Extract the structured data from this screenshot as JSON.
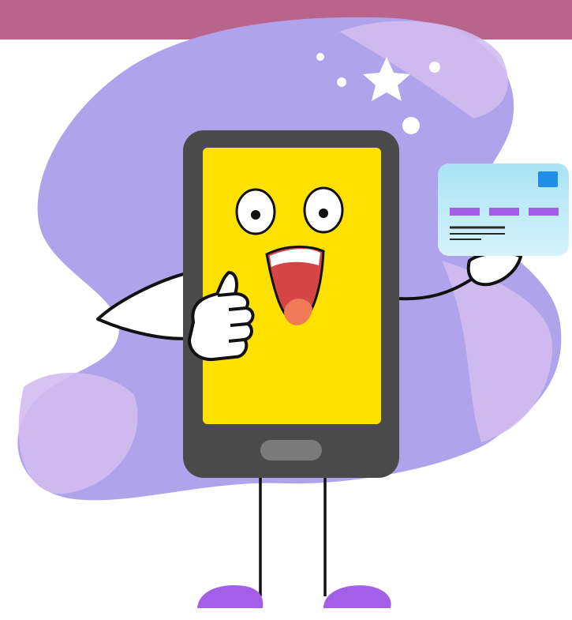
{
  "header": {
    "bar_color": "#B9648B"
  },
  "illustration": {
    "subject": "phone-mascot",
    "colors": {
      "blob_primary": "#AFA3EC",
      "blob_light": "#D2BDF0",
      "phone_body": "#4A4A4A",
      "phone_screen": "#FFE100",
      "home_button": "#7A7A7A",
      "mouth": "#D64545",
      "tongue": "#F07A55",
      "card_top": "#A9E3F5",
      "card_bottom": "#D6F3FB",
      "card_chip": "#1E8EE6",
      "card_stripe": "#A25EE6",
      "shoes": "#A35FE8",
      "outline": "#111111"
    },
    "icons": [
      "star-icon",
      "credit-card-icon",
      "thumbs-up-icon"
    ]
  }
}
